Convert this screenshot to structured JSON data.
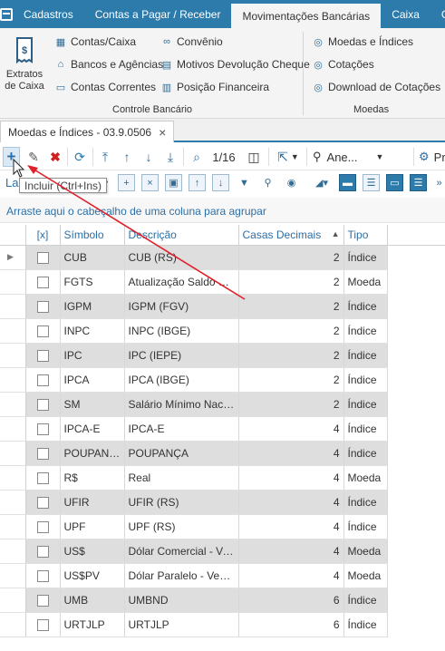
{
  "menubar": {
    "app_icon": "grid-menu-icon",
    "tabs": [
      "Cadastros",
      "Contas a Pagar / Receber",
      "Movimentações Bancárias",
      "Caixa",
      "Ge"
    ],
    "active_tab": "Movimentações Bancárias"
  },
  "ribbon": {
    "big_button_label": "Extratos de Caixa",
    "items": [
      "Contas/Caixa",
      "Bancos e Agências",
      "Contas Correntes",
      "Convênio",
      "Motivos Devolução Cheque",
      "Posição Financeira",
      "Moedas e Índices",
      "Cotações",
      "Download de Cotações"
    ],
    "groups": [
      "Controle Bancário",
      "Moedas"
    ]
  },
  "doc_tab": {
    "label": "Moedas e Índices - 03.9.0506",
    "close": "×"
  },
  "toolbar": {
    "page_indicator": "1/16",
    "attachments_label": "Ane...",
    "truncated_label": "Pr",
    "second_row_prefix": "La"
  },
  "tooltip": "Incluir (Ctrl+Ins)",
  "group_hint": "Arraste aqui o cabeçalho de uma coluna para agrupar",
  "grid": {
    "columns": [
      "[x]",
      "Símbolo",
      "Descrição",
      "Casas Decimais",
      "Tipo"
    ],
    "sort_indicator": "▲",
    "rows": [
      {
        "simbolo": "CUB",
        "descricao": "CUB (RS)",
        "casas": "2",
        "tipo": "Índice"
      },
      {
        "simbolo": "FGTS",
        "descricao": "Atualização Saldo FGTS",
        "casas": "2",
        "tipo": "Moeda"
      },
      {
        "simbolo": "IGPM",
        "descricao": "IGPM (FGV)",
        "casas": "2",
        "tipo": "Índice"
      },
      {
        "simbolo": "INPC",
        "descricao": "INPC (IBGE)",
        "casas": "2",
        "tipo": "Índice"
      },
      {
        "simbolo": "IPC",
        "descricao": "IPC (IEPE)",
        "casas": "2",
        "tipo": "Índice"
      },
      {
        "simbolo": "IPCA",
        "descricao": "IPCA (IBGE)",
        "casas": "2",
        "tipo": "Índice"
      },
      {
        "simbolo": "SM",
        "descricao": "Salário Mínimo Nacional",
        "casas": "2",
        "tipo": "Índice"
      },
      {
        "simbolo": "IPCA-E",
        "descricao": "IPCA-E",
        "casas": "4",
        "tipo": "Índice"
      },
      {
        "simbolo": "POUPANÇA",
        "descricao": "POUPANÇA",
        "casas": "4",
        "tipo": "Índice"
      },
      {
        "simbolo": "R$",
        "descricao": "Real",
        "casas": "4",
        "tipo": "Moeda"
      },
      {
        "simbolo": "UFIR",
        "descricao": "UFIR (RS)",
        "casas": "4",
        "tipo": "Índice"
      },
      {
        "simbolo": "UPF",
        "descricao": "UPF (RS)",
        "casas": "4",
        "tipo": "Índice"
      },
      {
        "simbolo": "US$",
        "descricao": "Dólar Comercial - Ven...",
        "casas": "4",
        "tipo": "Moeda"
      },
      {
        "simbolo": "US$PV",
        "descricao": "Dólar Paralelo - Venda",
        "casas": "4",
        "tipo": "Moeda"
      },
      {
        "simbolo": "UMB",
        "descricao": "UMBND",
        "casas": "6",
        "tipo": "Índice"
      },
      {
        "simbolo": "URTJLP",
        "descricao": "URTJLP",
        "casas": "6",
        "tipo": "Índice"
      }
    ]
  },
  "colors": {
    "accent": "#2d7bab",
    "annotation_arrow": "#e0202a",
    "alt_row": "#dedede"
  }
}
